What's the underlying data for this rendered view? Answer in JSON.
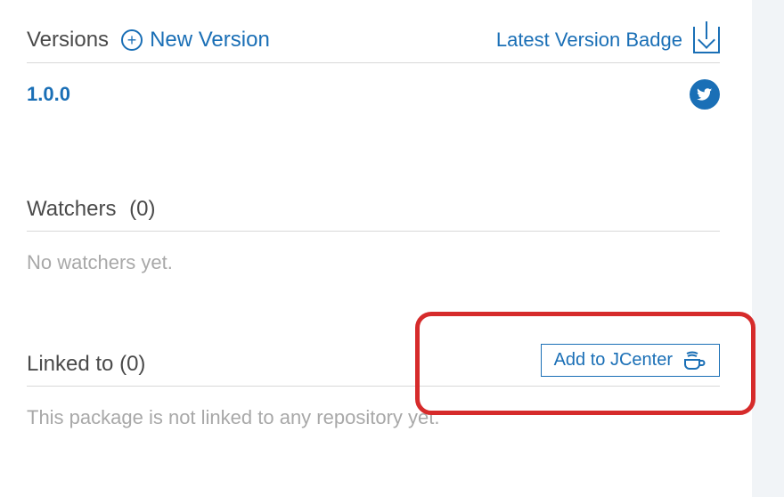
{
  "versions": {
    "heading": "Versions",
    "new_version_label": "New Version",
    "latest_badge_label": "Latest Version Badge",
    "list": [
      {
        "name": "1.0.0"
      }
    ]
  },
  "watchers": {
    "heading": "Watchers",
    "count_display": "(0)",
    "empty_message": "No watchers yet."
  },
  "linked_to": {
    "heading": "Linked to",
    "count_display": "(0)",
    "add_jcenter_label": "Add to JCenter",
    "empty_message": "This package is not linked to any repository yet."
  }
}
